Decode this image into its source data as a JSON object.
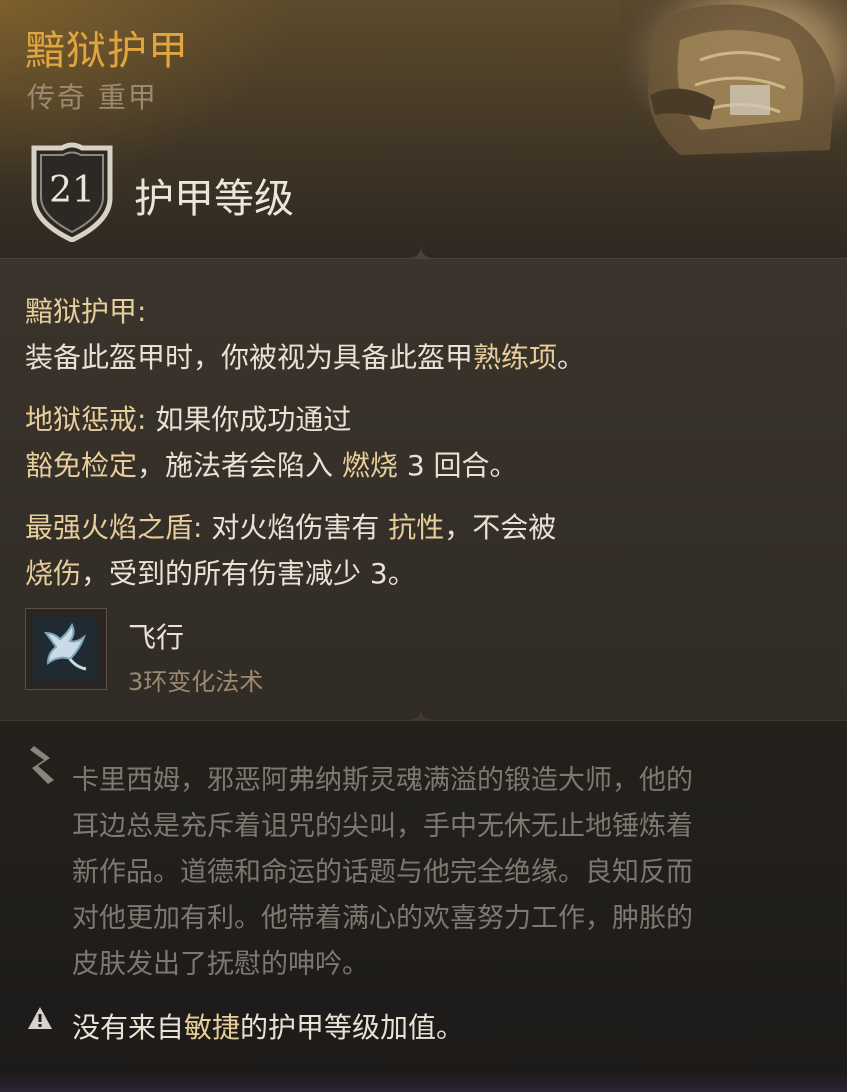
{
  "item": {
    "name": "黯狱护甲",
    "type": "传奇 重甲",
    "armor_class": "21",
    "armor_class_label": "护甲等级"
  },
  "properties": {
    "p1_title": "黯狱护甲:",
    "p1_line2_a": "装备此盔甲时，你被视为具备此盔甲",
    "p1_line2_hl": "熟练项",
    "p1_line2_b": "。",
    "p2_title": "地狱惩戒:",
    "p2_line1_rest": " 如果你成功通过",
    "p2_line2_hl1": "豁免检定",
    "p2_line2_a": "，施法者会陷入 ",
    "p2_line2_hl2": "燃烧",
    "p2_line2_b": " 3 回合。",
    "p3_title": "最强火焰之盾:",
    "p3_line1_a": " 对火焰伤害有 ",
    "p3_line1_hl": "抗性",
    "p3_line1_b": "，不会被",
    "p3_line2_hl": "烧伤",
    "p3_line2_b": "，受到的所有伤害减少 3。"
  },
  "spell": {
    "icon": "winged-flight-icon",
    "name": "飞行",
    "level": "3环变化法术"
  },
  "lore": {
    "icon": "quill-icon",
    "lines": [
      "卡里西姆，邪恶阿弗纳斯灵魂满溢的锻造大师，他的",
      "耳边总是充斥着诅咒的尖叫，手中无休无止地锤炼着",
      "新作品。道德和命运的话题与他完全绝缘。良知反而",
      "对他更加有利。他带着满心的欢喜努力工作，肿胀的",
      "皮肤发出了抚慰的呻吟。"
    ]
  },
  "warning": {
    "icon": "warning-triangle-icon",
    "text_a": "没有来自",
    "text_hl": "敏捷",
    "text_b": "的护甲等级加值。"
  },
  "colors": {
    "title_gold": "#e0a53e",
    "highlight": "#e6cd9a",
    "body_text": "#e8e1d4",
    "muted": "#9c8a70",
    "lore_text": "#7d7870"
  }
}
